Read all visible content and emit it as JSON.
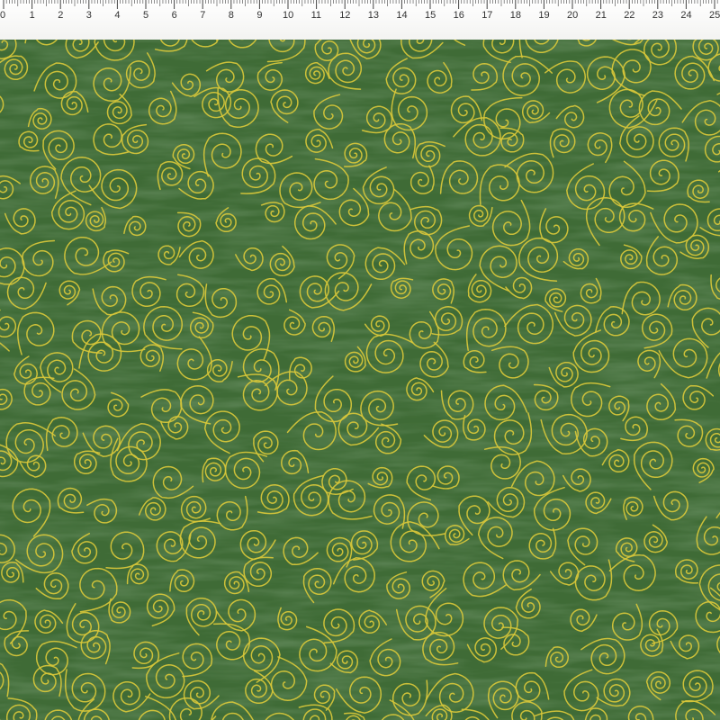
{
  "ruler": {
    "unit": "cm",
    "labels": [
      "0",
      "1",
      "2",
      "3",
      "4",
      "5",
      "6",
      "7",
      "8",
      "9",
      "10",
      "11",
      "12",
      "13",
      "14",
      "15",
      "16",
      "17",
      "18",
      "19",
      "20",
      "21",
      "22",
      "23",
      "24",
      "25"
    ]
  },
  "fabric": {
    "pattern": "gold swirl spirals on green",
    "colors": {
      "background": "#3f6b36",
      "background_dark": "#2f5229",
      "swirl": "#d9c83a"
    }
  }
}
